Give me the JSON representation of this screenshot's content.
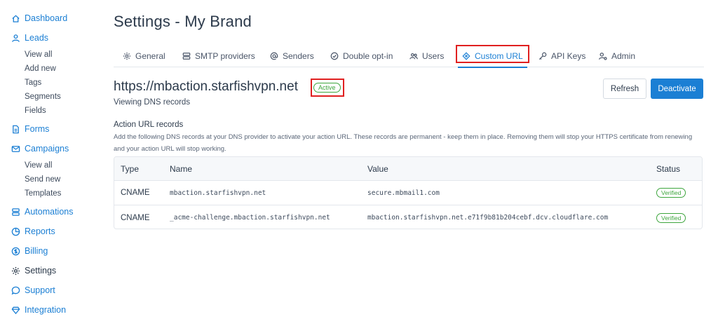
{
  "sidebar": {
    "items": [
      {
        "label": "Dashboard",
        "icon": "home-icon"
      },
      {
        "label": "Leads",
        "icon": "user-icon",
        "sub": [
          "View all",
          "Add new",
          "Tags",
          "Segments",
          "Fields"
        ]
      },
      {
        "label": "Forms",
        "icon": "document-icon"
      },
      {
        "label": "Campaigns",
        "icon": "mail-icon",
        "sub": [
          "View all",
          "Send new",
          "Templates"
        ]
      },
      {
        "label": "Automations",
        "icon": "automation-icon"
      },
      {
        "label": "Reports",
        "icon": "pie-chart-icon"
      },
      {
        "label": "Billing",
        "icon": "dollar-icon"
      },
      {
        "label": "Settings",
        "icon": "gear-icon"
      },
      {
        "label": "Support",
        "icon": "chat-icon"
      },
      {
        "label": "Integration",
        "icon": "diamond-icon"
      }
    ]
  },
  "page": {
    "title": "Settings - My Brand"
  },
  "tabs": [
    {
      "label": "General",
      "icon": "gear-icon"
    },
    {
      "label": "SMTP providers",
      "icon": "server-icon"
    },
    {
      "label": "Senders",
      "icon": "at-icon"
    },
    {
      "label": "Double opt-in",
      "icon": "check-circle-icon"
    },
    {
      "label": "Users",
      "icon": "users-icon"
    },
    {
      "label": "Custom URL",
      "icon": "diamond-icon",
      "active": true
    },
    {
      "label": "API Keys",
      "icon": "key-icon"
    },
    {
      "label": "Admin",
      "icon": "admin-icon"
    }
  ],
  "domain": {
    "url": "https://mbaction.starfishvpn.net",
    "status": "Active",
    "subtitle": "Viewing DNS records"
  },
  "actions": {
    "refresh": "Refresh",
    "deactivate": "Deactivate"
  },
  "records": {
    "title": "Action URL records",
    "description": "Add the following DNS records at your DNS provider to activate your action URL. These records are permanent - keep them in place. Removing them will stop your HTTPS certificate from renewing and your action URL will stop working.",
    "columns": [
      "Type",
      "Name",
      "Value",
      "Status"
    ],
    "rows": [
      {
        "type": "CNAME",
        "name": "mbaction.starfishvpn.net",
        "value": "secure.mbmail1.com",
        "status": "Verified"
      },
      {
        "type": "CNAME",
        "name": "_acme-challenge.mbaction.starfishvpn.net",
        "value": "mbaction.starfishvpn.net.e71f9b81b204cebf.dcv.cloudflare.com",
        "status": "Verified"
      }
    ]
  },
  "colors": {
    "accent": "#1b7fd4",
    "success": "#3ea63e",
    "highlight": "#e02020",
    "text": "#2c3a4b"
  }
}
